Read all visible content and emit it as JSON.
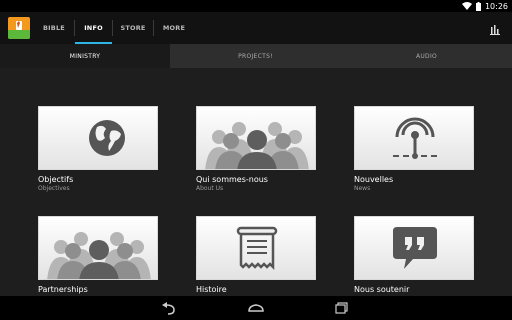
{
  "status": {
    "time": "10:26"
  },
  "app": {
    "logo_icon": "bible-app-logo-icon"
  },
  "tabs": [
    {
      "label": "BIBLE",
      "active": false
    },
    {
      "label": "INFO",
      "active": true
    },
    {
      "label": "STORE",
      "active": false
    },
    {
      "label": "MORE",
      "active": false
    }
  ],
  "subtabs": [
    {
      "label": "MINISTRY",
      "active": true
    },
    {
      "label": "PROJECTS!",
      "active": false
    },
    {
      "label": "AUDIO",
      "active": false
    }
  ],
  "tiles": [
    {
      "title": "Objectifs",
      "subtitle": "Objectives",
      "icon": "globe-icon"
    },
    {
      "title": "Qui sommes-nous",
      "subtitle": "About Us",
      "icon": "people-group-icon"
    },
    {
      "title": "Nouvelles",
      "subtitle": "News",
      "icon": "broadcast-icon"
    },
    {
      "title": "Partnerships",
      "subtitle": "",
      "icon": "people-group-icon"
    },
    {
      "title": "Histoire",
      "subtitle": "",
      "icon": "scroll-icon"
    },
    {
      "title": "Nous soutenir",
      "subtitle": "",
      "icon": "quote-bubble-icon"
    }
  ],
  "colors": {
    "accent": "#2fb4e6",
    "background": "#1e1e1e",
    "actionbar": "#121212"
  }
}
